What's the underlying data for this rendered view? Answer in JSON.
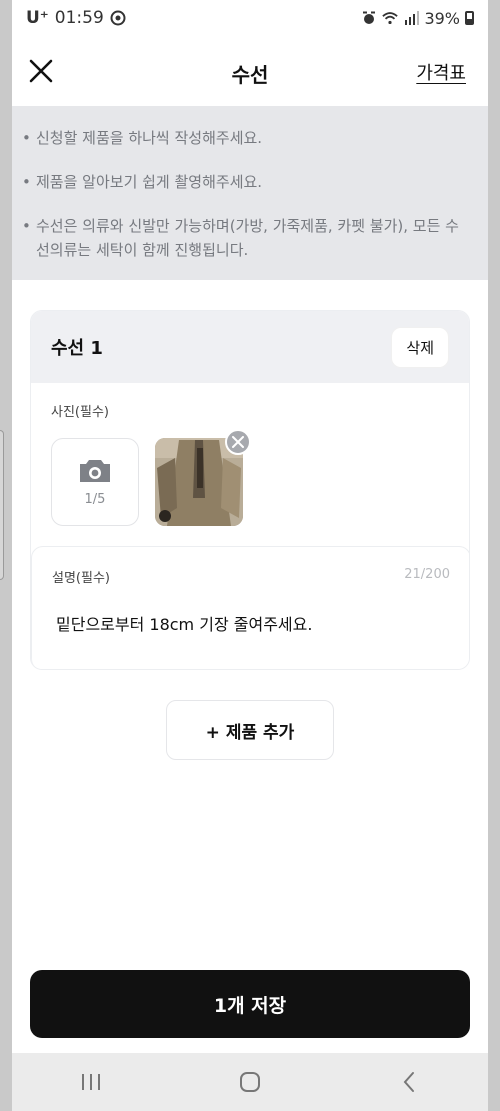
{
  "status_bar": {
    "carrier": "U⁺",
    "time": "01:59",
    "battery": "39%"
  },
  "header": {
    "title": "수선",
    "price_link": "가격표"
  },
  "notices": [
    "신청할 제품을 하나씩 작성해주세요.",
    "제품을 알아보기 쉽게 촬영해주세요.",
    "수선은 의류와 신발만 가능하며(가방, 가죽제품, 카펫 불가), 모든 수선의류는 세탁이 함께 진행됩니다."
  ],
  "card": {
    "title": "수선 1",
    "delete_label": "삭제",
    "photo_label": "사진(필수)",
    "photo_count": "1/5",
    "desc_label": "설명(필수)",
    "desc_count": "21/200",
    "desc_text": "밑단으로부터 18cm 기장 줄여주세요."
  },
  "add_product_label": "+ 제품 추가",
  "save_label": "1개 저장",
  "colors": {
    "primary": "#111111",
    "notice_bg": "#e6e7ea",
    "muted": "#777a80"
  }
}
